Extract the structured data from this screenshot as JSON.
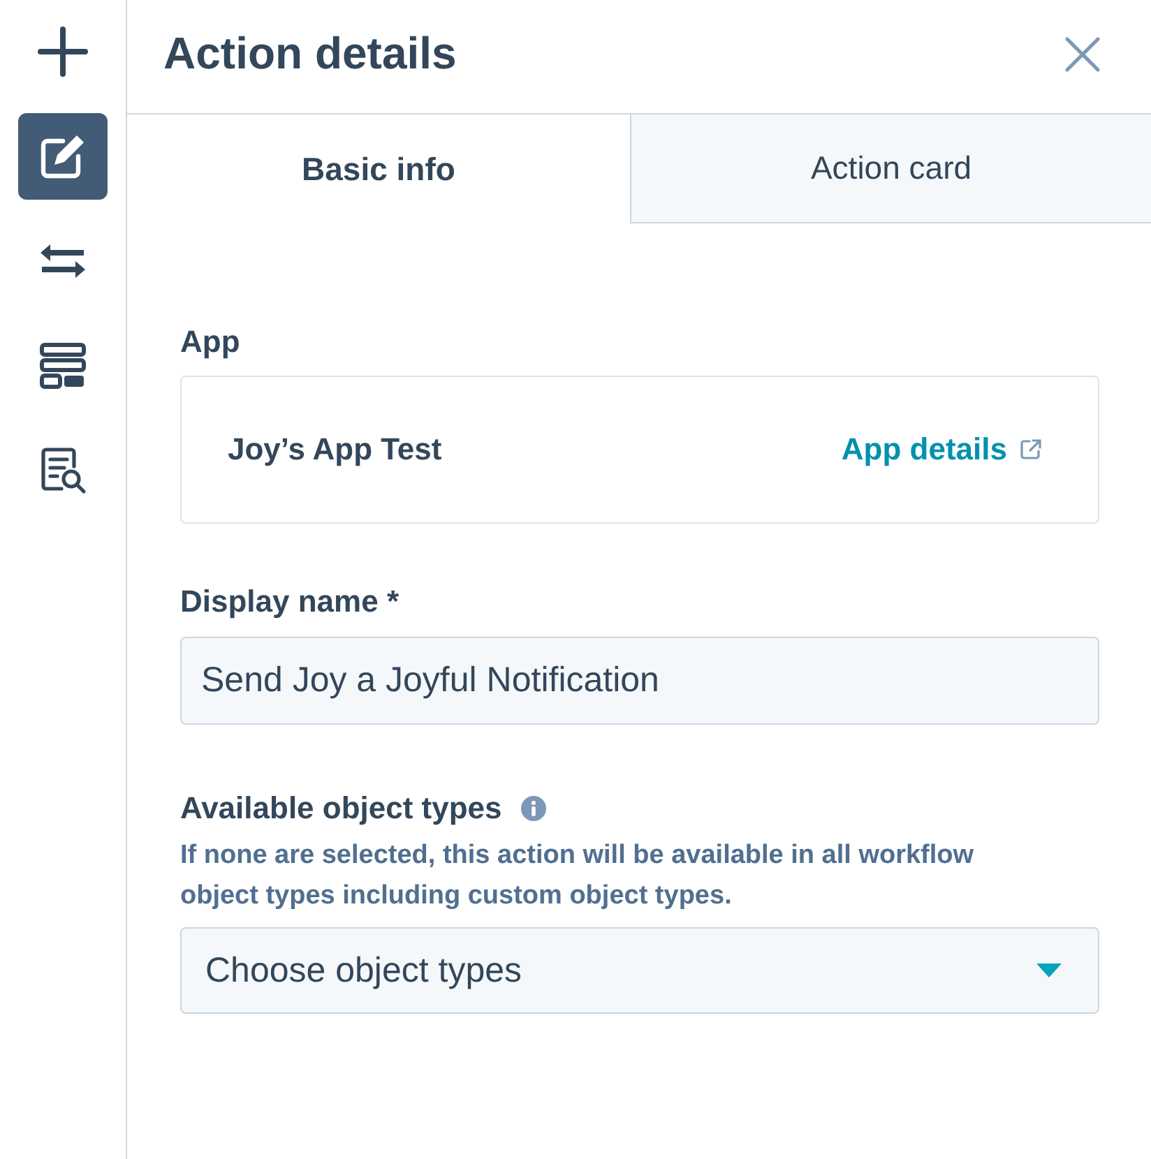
{
  "sidebar": {
    "items": [
      {
        "kind": "add",
        "selected": false
      },
      {
        "kind": "edit",
        "selected": true
      },
      {
        "kind": "swap",
        "selected": false
      },
      {
        "kind": "layout",
        "selected": false
      },
      {
        "kind": "document-search",
        "selected": false
      }
    ]
  },
  "panel": {
    "title": "Action details"
  },
  "tabs": [
    {
      "label": "Basic info",
      "selected": true
    },
    {
      "label": "Action card",
      "selected": false
    }
  ],
  "app": {
    "label": "App",
    "name": "Joy’s App Test",
    "link": "App details"
  },
  "display_name": {
    "label": "Display name *",
    "value": "Send Joy a Joyful Notification"
  },
  "object_types": {
    "label": "Available object types",
    "help": "If none are selected, this action will be available in all workflow object types including custom object types.",
    "placeholder": "Choose object types"
  }
}
